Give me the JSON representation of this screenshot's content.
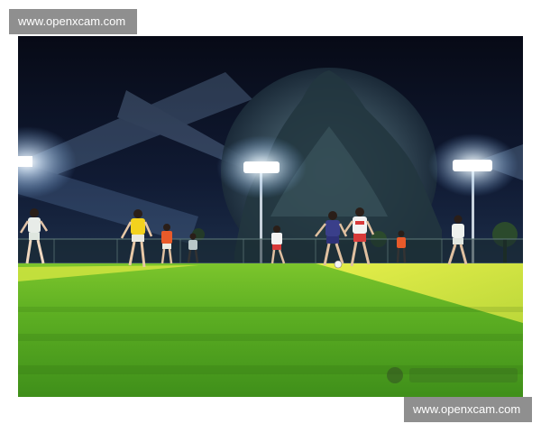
{
  "watermark": {
    "top_text": "www.openxcam.com",
    "bottom_text": "www.openxcam.com"
  },
  "photo": {
    "subject": "Night-time amateur soccer match on an artificial turf pitch under floodlights",
    "colors": {
      "sky": "#0b0f1e",
      "turf": "#4ea21f",
      "turf_bright": "#d6e83a",
      "floodlight": "#ffffff",
      "badge": "#8f8f8f"
    }
  }
}
